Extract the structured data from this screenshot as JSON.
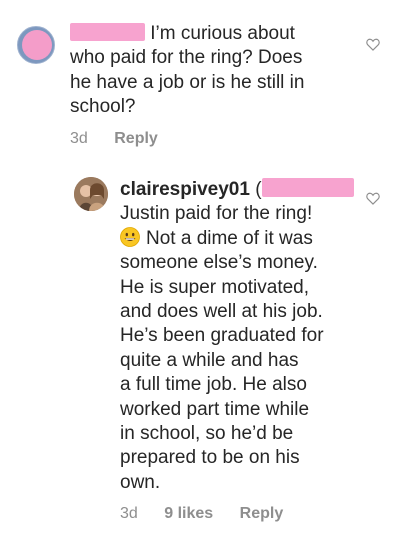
{
  "comment1": {
    "username": "",
    "lines": [
      "I’m curious about",
      "who paid for the ring? Does",
      "he have a job or is he still in",
      "school?"
    ],
    "time": "3d",
    "reply_label": "Reply"
  },
  "comment2": {
    "username": "clairespivey01",
    "open_paren": "(",
    "lines": [
      "Justin paid for the ring!",
      "Not a dime of it was",
      "someone else’s money.",
      "He is super motivated,",
      "and does well at his job.",
      "He’s been graduated for",
      "quite a while and has",
      "a full time job. He also",
      "worked part time while",
      "in school, so he’d be",
      "prepared to be on his",
      "own."
    ],
    "emoji": "grinning-face-emoji",
    "time": "3d",
    "likes": "9 likes",
    "reply_label": "Reply"
  },
  "colors": {
    "redaction": "#f7a3cf",
    "meta": "#8e8e8e",
    "text": "#262626"
  }
}
